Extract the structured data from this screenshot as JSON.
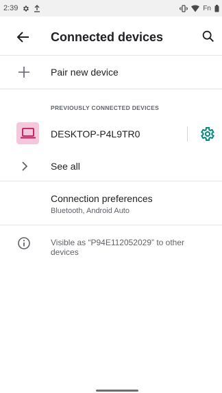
{
  "status_bar": {
    "time": "2:39",
    "left_icons": [
      "settings-icon",
      "upload-icon"
    ],
    "carrier_text": "Fn",
    "right_icons": [
      "vibrate-icon",
      "wifi-icon",
      "battery-icon"
    ]
  },
  "app_bar": {
    "title": "Connected devices",
    "back_icon": "arrow-back-icon",
    "search_icon": "search-icon"
  },
  "pair": {
    "label": "Pair new device",
    "icon": "plus-icon"
  },
  "previously_connected": {
    "header": "PREVIOUSLY CONNECTED DEVICES",
    "device_name": "DESKTOP-P4L9TR0",
    "device_icon": "laptop-icon",
    "settings_icon": "gear-icon"
  },
  "see_all": {
    "label": "See all",
    "icon": "chevron-right-icon"
  },
  "preferences": {
    "title": "Connection preferences",
    "subtitle": "Bluetooth, Android Auto"
  },
  "info": {
    "text": "Visible as “P94E112052029” to other devices",
    "icon": "info-icon"
  },
  "colors": {
    "accent": "#00897b",
    "device_bg": "#f4c7dd",
    "device_icon": "#c2185b"
  }
}
